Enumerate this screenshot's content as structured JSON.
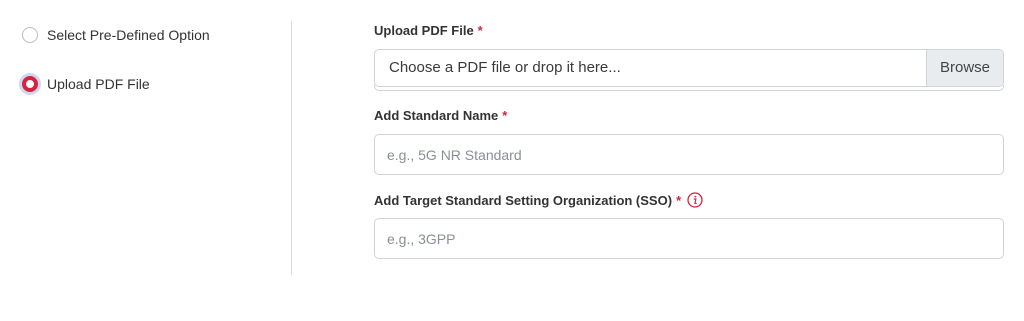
{
  "options": {
    "predefined_label": "Select Pre-Defined Option",
    "upload_label": "Upload PDF File",
    "selected": "upload"
  },
  "upload": {
    "label": "Upload PDF File",
    "required_mark": "*",
    "placeholder": "Choose a PDF file or drop it here...",
    "browse_label": "Browse"
  },
  "standard_name": {
    "label": "Add Standard Name",
    "required_mark": "*",
    "placeholder": "e.g., 5G NR Standard"
  },
  "sso": {
    "label": "Add Target Standard Setting Organization (SSO)",
    "required_mark": "*",
    "info_icon": "info-icon",
    "placeholder": "e.g., 3GPP"
  },
  "colors": {
    "accent": "#d9233c",
    "focus_ring": "#cdd6f5",
    "border": "#cfd3d8",
    "button_bg": "#e9ecef"
  }
}
